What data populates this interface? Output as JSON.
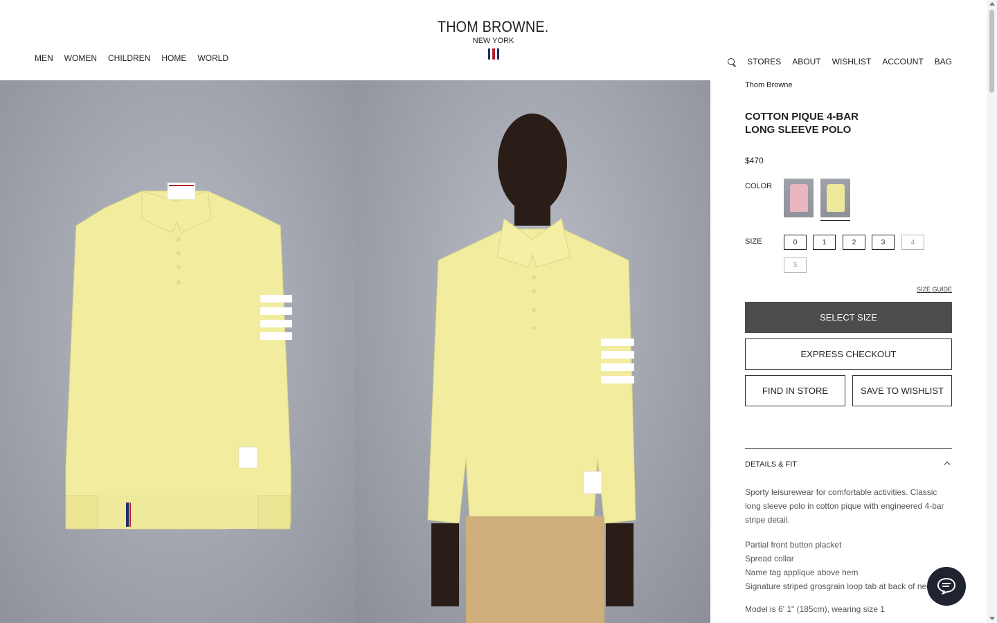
{
  "header": {
    "logo_main": "THOM BROWNE.",
    "logo_sub": "NEW YORK",
    "nav_left": [
      "MEN",
      "WOMEN",
      "CHILDREN",
      "HOME",
      "WORLD"
    ],
    "nav_right": [
      "STORES",
      "ABOUT",
      "WISHLIST",
      "ACCOUNT",
      "BAG"
    ]
  },
  "product": {
    "brand": "Thom Browne",
    "title": "COTTON PIQUE 4-BAR LONG SLEEVE POLO",
    "price": "$470",
    "color_label": "COLOR",
    "colors": [
      {
        "name": "pink",
        "hex": "#e9b6c0"
      },
      {
        "name": "yellow",
        "hex": "#ece99a",
        "selected": true
      }
    ],
    "size_label": "SIZE",
    "sizes": [
      {
        "label": "0",
        "available": true
      },
      {
        "label": "1",
        "available": true
      },
      {
        "label": "2",
        "available": true
      },
      {
        "label": "3",
        "available": true
      },
      {
        "label": "4",
        "available": false
      },
      {
        "label": "5",
        "available": false
      }
    ],
    "size_guide": "SIZE GUIDE",
    "select_size": "SELECT SIZE",
    "express_checkout": "EXPRESS CHECKOUT",
    "find_in_store": "FIND IN STORE",
    "save_to_wishlist": "SAVE TO WISHLIST",
    "details_title": "DETAILS & FIT",
    "description": "Sporty leisurewear for comfortable activities. Classic long sleeve polo in cotton pique with engineered 4-bar stripe detail.",
    "bullets": [
      "Partial front button placket",
      "Spread collar",
      "Name tag applique above hem",
      "Signature striped grosgrain loop tab at back of neck"
    ],
    "model_note": "Model is 6' 1\" (185cm), wearing size 1"
  },
  "colors": {
    "shirt_yellow": "#f1ec9e",
    "chat_bg": "#1f2430",
    "primary_button": "#4c4c4c",
    "flag_blue": "#1d2b6b",
    "flag_red": "#b3202a"
  }
}
